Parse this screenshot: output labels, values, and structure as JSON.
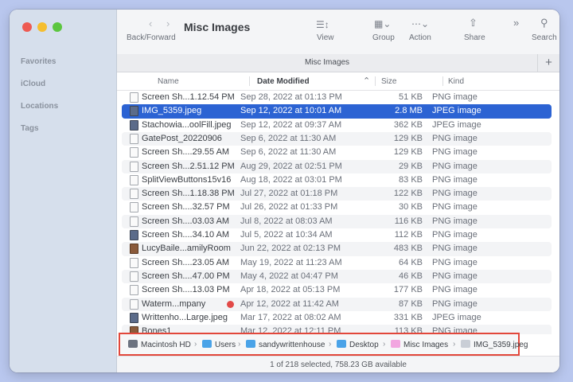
{
  "window": {
    "title": "Misc Images"
  },
  "sidebar": {
    "items": [
      {
        "label": "Favorites"
      },
      {
        "label": "iCloud"
      },
      {
        "label": "Locations"
      },
      {
        "label": "Tags"
      }
    ]
  },
  "toolbar": {
    "back_forward_label": "Back/Forward",
    "view_label": "View",
    "group_label": "Group",
    "action_label": "Action",
    "share_label": "Share",
    "search_label": "Search"
  },
  "tabbar": {
    "title": "Misc Images",
    "add_label": "+"
  },
  "columns": {
    "name": "Name",
    "date": "Date Modified",
    "size": "Size",
    "kind": "Kind"
  },
  "files": [
    {
      "name": "Screen Sh...1.12.54 PM",
      "date": "Sep 28, 2022 at 01:13 PM",
      "size": "51 KB",
      "kind": "PNG image",
      "icon": "doc"
    },
    {
      "name": "IMG_5359.jpeg",
      "date": "Sep 12, 2022 at 10:01 AM",
      "size": "2.8 MB",
      "kind": "JPEG image",
      "icon": "img",
      "selected": true
    },
    {
      "name": "Stachowia...oolFill.jpeg",
      "date": "Sep 12, 2022 at 09:37 AM",
      "size": "362 KB",
      "kind": "JPEG image",
      "icon": "img"
    },
    {
      "name": "GatePost_20220906",
      "date": "Sep 6, 2022 at 11:30 AM",
      "size": "129 KB",
      "kind": "PNG image",
      "icon": "doc"
    },
    {
      "name": "Screen Sh....29.55 AM",
      "date": "Sep 6, 2022 at 11:30 AM",
      "size": "129 KB",
      "kind": "PNG image",
      "icon": "doc"
    },
    {
      "name": "Screen Sh...2.51.12 PM",
      "date": "Aug 29, 2022 at 02:51 PM",
      "size": "29 KB",
      "kind": "PNG image",
      "icon": "doc"
    },
    {
      "name": "SplitViewButtons15v16",
      "date": "Aug 18, 2022 at 03:01 PM",
      "size": "83 KB",
      "kind": "PNG image",
      "icon": "doc"
    },
    {
      "name": "Screen Sh...1.18.38 PM",
      "date": "Jul 27, 2022 at 01:18 PM",
      "size": "122 KB",
      "kind": "PNG image",
      "icon": "doc"
    },
    {
      "name": "Screen Sh....32.57 PM",
      "date": "Jul 26, 2022 at 01:33 PM",
      "size": "30 KB",
      "kind": "PNG image",
      "icon": "doc"
    },
    {
      "name": "Screen Sh....03.03 AM",
      "date": "Jul 8, 2022 at 08:03 AM",
      "size": "116 KB",
      "kind": "PNG image",
      "icon": "doc"
    },
    {
      "name": "Screen Sh....34.10 AM",
      "date": "Jul 5, 2022 at 10:34 AM",
      "size": "112 KB",
      "kind": "PNG image",
      "icon": "img"
    },
    {
      "name": "LucyBaile...amilyRoom",
      "date": "Jun 22, 2022 at 02:13 PM",
      "size": "483 KB",
      "kind": "PNG image",
      "icon": "photo"
    },
    {
      "name": "Screen Sh....23.05 AM",
      "date": "May 19, 2022 at 11:23 AM",
      "size": "64 KB",
      "kind": "PNG image",
      "icon": "doc"
    },
    {
      "name": "Screen Sh....47.00 PM",
      "date": "May 4, 2022 at 04:47 PM",
      "size": "46 KB",
      "kind": "PNG image",
      "icon": "doc"
    },
    {
      "name": "Screen Sh....13.03 PM",
      "date": "Apr 18, 2022 at 05:13 PM",
      "size": "177 KB",
      "kind": "PNG image",
      "icon": "doc"
    },
    {
      "name": "Waterm...mpany",
      "date": "Apr 12, 2022 at 11:42 AM",
      "size": "87 KB",
      "kind": "PNG image",
      "icon": "doc",
      "tag": "red"
    },
    {
      "name": "Writtenho...Large.jpeg",
      "date": "Mar 17, 2022 at 08:02 AM",
      "size": "331 KB",
      "kind": "JPEG image",
      "icon": "img"
    },
    {
      "name": "Bones1",
      "date": "Mar 12, 2022 at 12:11 PM",
      "size": "113 KB",
      "kind": "PNG image",
      "icon": "photo"
    }
  ],
  "pathbar": {
    "segments": [
      {
        "label": "Macintosh HD",
        "icon": "disk-icon"
      },
      {
        "label": "Users",
        "icon": "folder-icon"
      },
      {
        "label": "sandywrittenhouse",
        "icon": "folder-icon"
      },
      {
        "label": "Desktop",
        "icon": "folder-icon"
      },
      {
        "label": "Misc Images",
        "icon": "folder-icon"
      },
      {
        "label": "IMG_5359.jpeg",
        "icon": "image-file-icon"
      }
    ],
    "highlight_color": "#e2473b"
  },
  "status": {
    "text": "1 of 218 selected, 758.23 GB available"
  },
  "colors": {
    "selection": "#2c63d3",
    "tag_red": "#e24a48"
  }
}
